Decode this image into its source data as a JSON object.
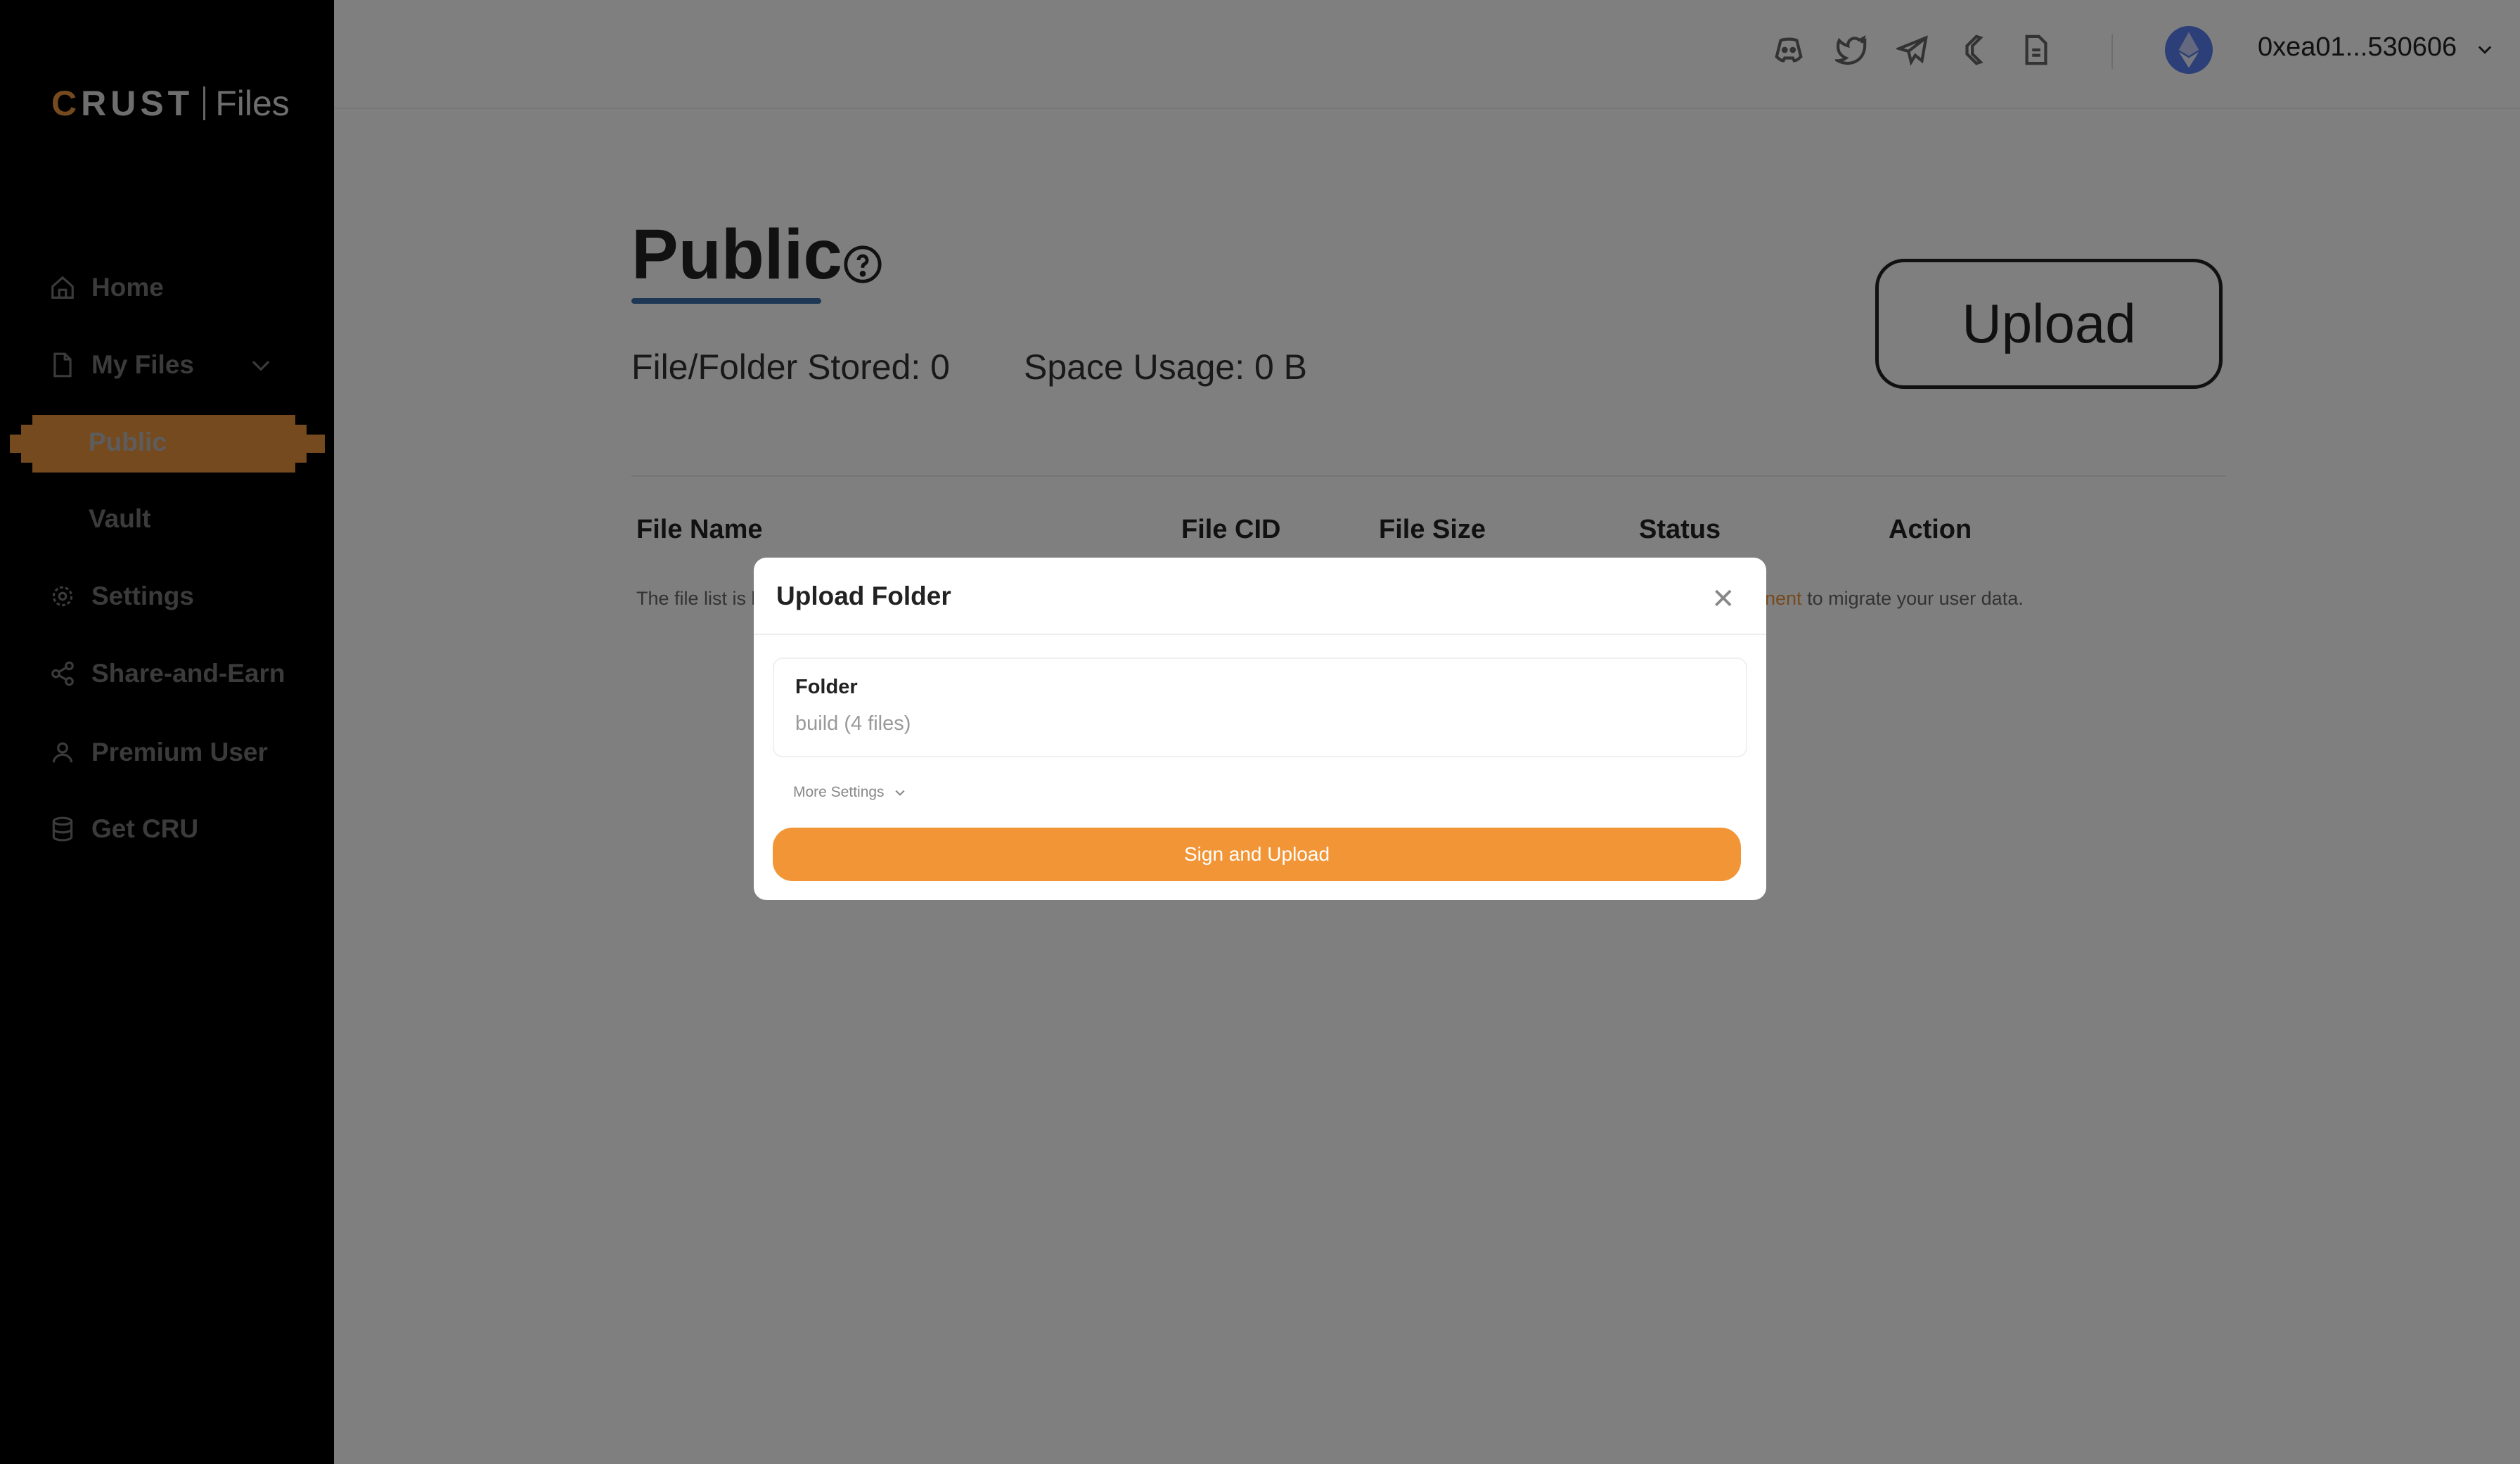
{
  "sidebar": {
    "logo": {
      "brand": "CRUST",
      "product": "Files"
    },
    "items": [
      {
        "label": "Home",
        "icon": "home-icon"
      },
      {
        "label": "My Files",
        "icon": "file-icon"
      },
      {
        "label": "Public"
      },
      {
        "label": "Vault"
      },
      {
        "label": "Settings",
        "icon": "gear-icon"
      },
      {
        "label": "Share-and-Earn",
        "icon": "share-icon"
      },
      {
        "label": "Premium User",
        "icon": "user-icon"
      },
      {
        "label": "Get CRU",
        "icon": "database-icon"
      }
    ],
    "active": "Public"
  },
  "header": {
    "icons": [
      "discord-icon",
      "twitter-icon",
      "telegram-icon",
      "crust-icon",
      "document-icon"
    ],
    "wallet": {
      "icon": "ethereum-icon",
      "address": "0xea01...530606"
    }
  },
  "main": {
    "title": "Public",
    "stats": {
      "stored": "File/Folder Stored: 0",
      "usage": "Space Usage: 0 B"
    },
    "upload_label": "Upload",
    "columns": [
      "File Name",
      "File CID",
      "File Size",
      "Status",
      "Action"
    ],
    "note_left": "The file list is l",
    "note_link": "nent",
    "note_right": " to migrate your user data."
  },
  "modal": {
    "title": "Upload Folder",
    "field_label": "Folder",
    "field_value": "build (4 files)",
    "more_settings": "More Settings",
    "submit_label": "Sign and Upload"
  },
  "colors": {
    "accent": "#f29536",
    "sidebar_bg": "#000000",
    "title_underline": "#3b6ea8"
  }
}
